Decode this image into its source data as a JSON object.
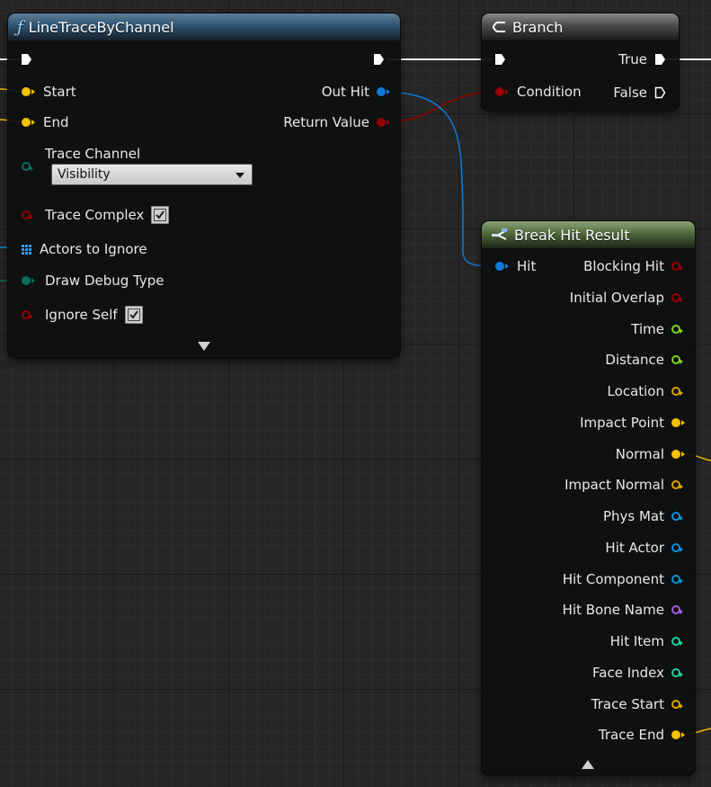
{
  "colors": {
    "exec": "#ffffff",
    "vector": "#f5c000",
    "bool": "#950000",
    "object": "#0d7ad8",
    "float": "#7ed321",
    "name": "#a55ee0",
    "int": "#1fcfa0",
    "byte": "#0b6e5c",
    "struct_hollow": "#f5c000"
  },
  "line_trace": {
    "title": "LineTraceByChannel",
    "icon": "function-icon",
    "inputs": {
      "start": "Start",
      "end": "End",
      "trace_channel": "Trace Channel",
      "trace_channel_value": "Visibility",
      "trace_complex": "Trace Complex",
      "actors_to_ignore": "Actors to Ignore",
      "draw_debug_type": "Draw Debug Type",
      "ignore_self": "Ignore Self"
    },
    "outputs": {
      "out_hit": "Out Hit",
      "return_value": "Return Value"
    }
  },
  "branch": {
    "title": "Branch",
    "icon": "branch-icon",
    "condition": "Condition",
    "true_label": "True",
    "false_label": "False"
  },
  "break_hit": {
    "title": "Break Hit Result",
    "icon": "break-struct-icon",
    "input": "Hit",
    "outputs": [
      {
        "label": "Blocking Hit",
        "color": "#950000",
        "filled": false
      },
      {
        "label": "Initial Overlap",
        "color": "#950000",
        "filled": false
      },
      {
        "label": "Time",
        "color": "#7ed321",
        "filled": false
      },
      {
        "label": "Distance",
        "color": "#7ed321",
        "filled": false
      },
      {
        "label": "Location",
        "color": "#d9a400",
        "filled": false
      },
      {
        "label": "Impact Point",
        "color": "#f5c000",
        "filled": true
      },
      {
        "label": "Normal",
        "color": "#f5c000",
        "filled": true
      },
      {
        "label": "Impact Normal",
        "color": "#d9a400",
        "filled": false
      },
      {
        "label": "Phys Mat",
        "color": "#0f8fd8",
        "filled": false
      },
      {
        "label": "Hit Actor",
        "color": "#0f8fd8",
        "filled": false
      },
      {
        "label": "Hit Component",
        "color": "#0f8fd8",
        "filled": false
      },
      {
        "label": "Hit Bone Name",
        "color": "#a55ee0",
        "filled": false
      },
      {
        "label": "Hit Item",
        "color": "#1fcfa0",
        "filled": false
      },
      {
        "label": "Face Index",
        "color": "#1fcfa0",
        "filled": false
      },
      {
        "label": "Trace Start",
        "color": "#d9a400",
        "filled": false
      },
      {
        "label": "Trace End",
        "color": "#f5c000",
        "filled": true
      }
    ]
  }
}
